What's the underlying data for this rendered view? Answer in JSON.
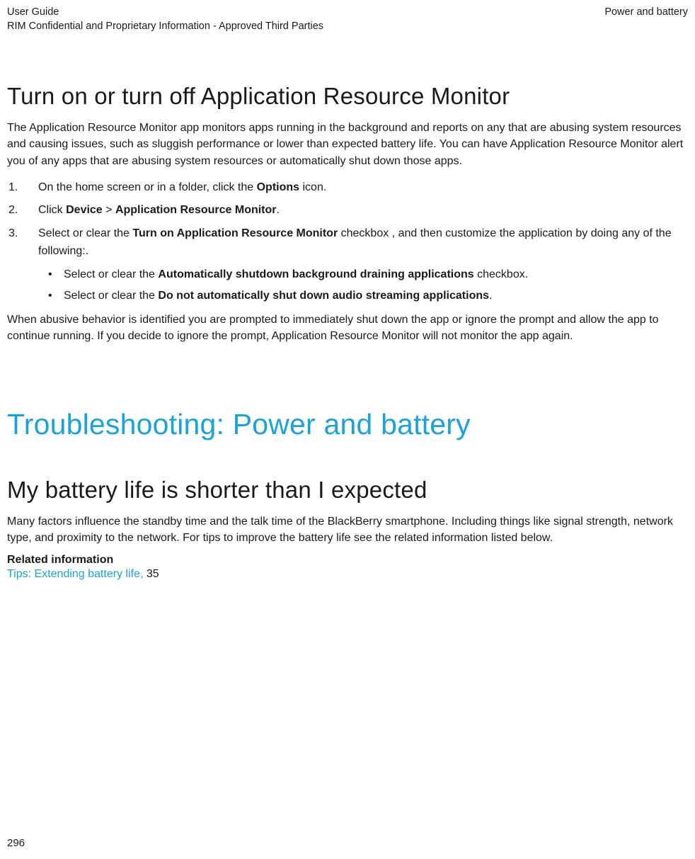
{
  "header": {
    "left_line1": "User Guide",
    "left_line2": "RIM Confidential and Proprietary Information - Approved Third Parties",
    "right": "Power and battery"
  },
  "section1": {
    "title": "Turn on or turn off Application Resource Monitor",
    "intro": "The Application Resource Monitor app monitors apps running in the background and reports on any that are abusing system resources and causing issues, such as sluggish performance or lower than expected battery life. You can have Application Resource Monitor alert you of any apps that are abusing system resources or automatically shut down those apps.",
    "step1_pre": "On the home screen or in a folder, click the ",
    "step1_bold": "Options",
    "step1_post": " icon.",
    "step2_pre": "Click ",
    "step2_b1": "Device",
    "step2_mid": " > ",
    "step2_b2": "Application Resource Monitor",
    "step2_post": ".",
    "step3_pre": "Select or clear the ",
    "step3_bold": "Turn on Application Resource Monitor",
    "step3_post": " checkbox , and then customize the application by doing any of the following:.",
    "sub1_pre": "Select or clear the ",
    "sub1_bold": "Automatically shutdown background draining applications",
    "sub1_post": " checkbox.",
    "sub2_pre": "Select or clear the ",
    "sub2_bold": "Do not automatically shut down audio streaming applications",
    "sub2_post": ".",
    "para2": "When abusive behavior is identified you are prompted to immediately shut down the app or ignore the prompt and allow the app to continue running. If you decide to ignore the prompt, Application Resource Monitor will not monitor the app again."
  },
  "chapter": {
    "title": "Troubleshooting: Power and battery"
  },
  "section2": {
    "title": "My battery life is shorter than I expected",
    "para": "Many factors influence the standby time and the talk time of the BlackBerry smartphone. Including things like signal strength, network type, and proximity to the network. For tips to improve the battery life see the related information listed below.",
    "related_heading": "Related information",
    "link_text": "Tips: Extending battery life, ",
    "link_page": "35"
  },
  "page_number": "296"
}
